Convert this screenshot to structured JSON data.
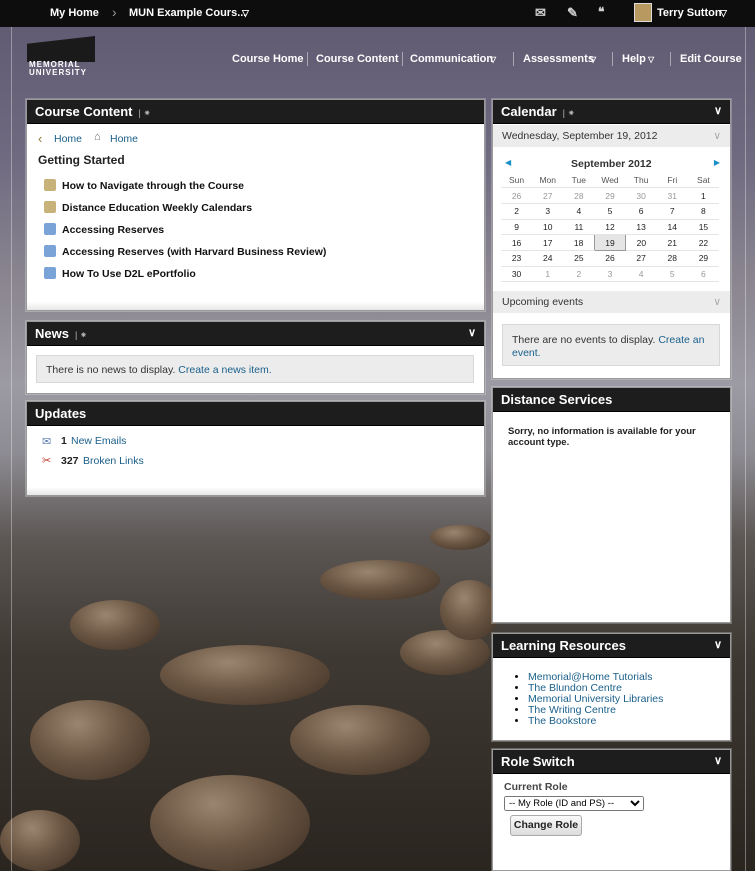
{
  "topbar": {
    "home": "My Home",
    "course": "MUN Example Cours...",
    "user": "Terry Sutton"
  },
  "logo": {
    "line1": "MEMORIAL",
    "line2": "UNIVERSITY"
  },
  "nav": {
    "course_home": "Course Home",
    "course_content": "Course Content",
    "communication": "Communication",
    "assessments": "Assessments",
    "help": "Help",
    "edit_course": "Edit Course"
  },
  "course_content": {
    "title": "Course Content",
    "breadcrumb_back": "Home",
    "breadcrumb_home": "Home",
    "heading": "Getting Started",
    "items": [
      "How to Navigate through the Course",
      "Distance Education Weekly Calendars",
      "Accessing Reserves",
      "Accessing Reserves (with Harvard Business Review)",
      "How To Use D2L ePortfolio"
    ]
  },
  "news": {
    "title": "News",
    "empty": "There is no news to display.",
    "create": "Create a news item."
  },
  "updates": {
    "title": "Updates",
    "emails_count": "1",
    "emails_label": "New Emails",
    "links_count": "327",
    "links_label": "Broken Links"
  },
  "calendar": {
    "title": "Calendar",
    "date_header": "Wednesday, September 19, 2012",
    "month": "September 2012",
    "weekdays": [
      "Sun",
      "Mon",
      "Tue",
      "Wed",
      "Thu",
      "Fri",
      "Sat"
    ],
    "weeks": [
      [
        "26",
        "27",
        "28",
        "29",
        "30",
        "31",
        "1"
      ],
      [
        "2",
        "3",
        "4",
        "5",
        "6",
        "7",
        "8"
      ],
      [
        "9",
        "10",
        "11",
        "12",
        "13",
        "14",
        "15"
      ],
      [
        "16",
        "17",
        "18",
        "19",
        "20",
        "21",
        "22"
      ],
      [
        "23",
        "24",
        "25",
        "26",
        "27",
        "28",
        "29"
      ],
      [
        "30",
        "1",
        "2",
        "3",
        "4",
        "5",
        "6"
      ]
    ],
    "upcoming": "Upcoming events",
    "empty": "There are no events to display.",
    "create": "Create an event."
  },
  "distance_services": {
    "title": "Distance Services",
    "message": "Sorry, no information is available for your account type."
  },
  "learning_resources": {
    "title": "Learning Resources",
    "links": [
      "Memorial@Home Tutorials",
      "The Blundon Centre",
      "Memorial University Libraries",
      "The Writing Centre",
      "The Bookstore"
    ]
  },
  "role_switch": {
    "title": "Role Switch",
    "label": "Current Role",
    "selected": "-- My Role (ID and PS) --",
    "button": "Change Role"
  }
}
